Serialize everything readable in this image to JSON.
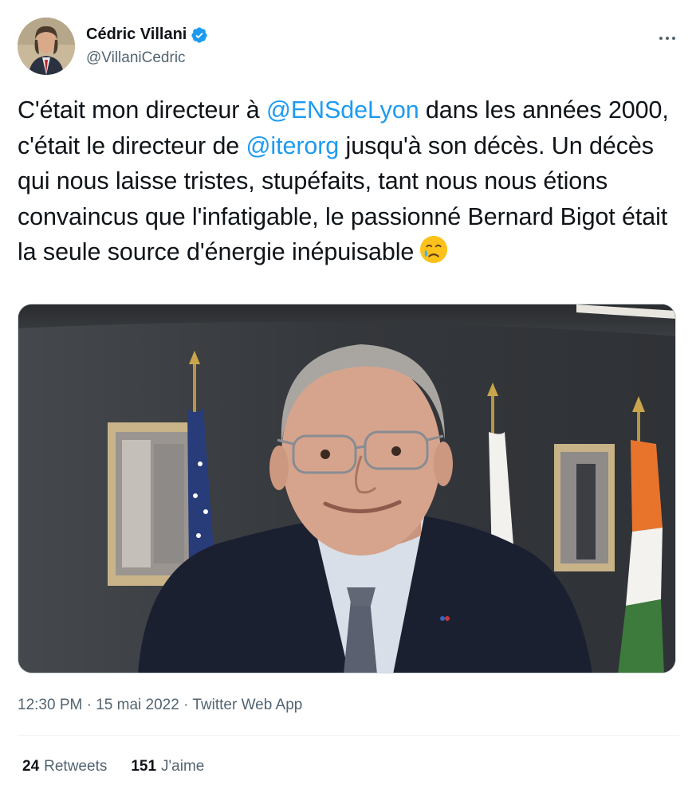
{
  "author": {
    "display_name": "Cédric Villani",
    "handle": "@VillaniCedric",
    "verified_icon": "verified-badge-icon",
    "avatar_icon": "avatar"
  },
  "tweet": {
    "text_1": "C'était mon directeur à ",
    "mention_1": "@ENSdeLyon",
    "text_2": " dans les années 2000, c'était le directeur de ",
    "mention_2": "@iterorg",
    "text_3": " jusqu'à son décès. Un décès qui nous laisse tristes, stupéfaits, tant nous nous étions convaincus que l'infatigable, le passionné Bernard Bigot était la seule source d'énergie inépuisable",
    "emoji": "crying-face-emoji"
  },
  "meta": {
    "time": "12:30 PM",
    "date": "15 mai 2022",
    "source": "Twitter Web App",
    "separator": " · "
  },
  "stats": {
    "retweets_count": "24",
    "retweets_label": "Retweets",
    "likes_count": "151",
    "likes_label": "J'aime"
  },
  "colors": {
    "link": "#1d9bf0",
    "verified": "#1d9bf0",
    "secondary_text": "#536471",
    "primary_text": "#0f1419"
  }
}
